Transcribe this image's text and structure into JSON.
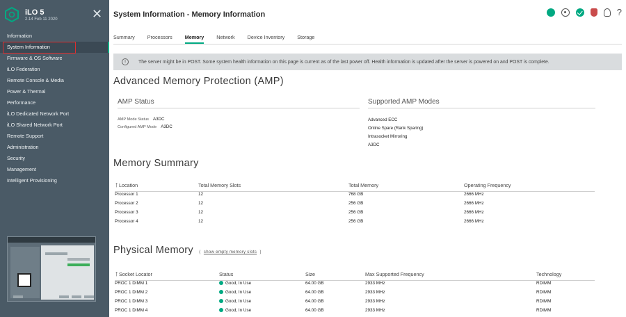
{
  "brand": {
    "title": "iLO 5",
    "subtitle": "2.14 Feb 11 2020"
  },
  "sidebar": {
    "items": [
      {
        "label": "Information"
      },
      {
        "label": "System Information"
      },
      {
        "label": "Firmware & OS Software"
      },
      {
        "label": "iLO Federation"
      },
      {
        "label": "Remote Console & Media"
      },
      {
        "label": "Power & Thermal"
      },
      {
        "label": "Performance"
      },
      {
        "label": "iLO Dedicated Network Port"
      },
      {
        "label": "iLO Shared Network Port"
      },
      {
        "label": "Remote Support"
      },
      {
        "label": "Administration"
      },
      {
        "label": "Security"
      },
      {
        "label": "Management"
      },
      {
        "label": "Intelligent Provisioning"
      }
    ],
    "active_index": 1
  },
  "header": {
    "title": "System Information - Memory Information",
    "help": "?"
  },
  "tabs": [
    "Summary",
    "Processors",
    "Memory",
    "Network",
    "Device Inventory",
    "Storage"
  ],
  "active_tab": "Memory",
  "notice": "The server might be in POST. Some system health information on this page is current as of the last power off. Health information is updated after the server is powered on and POST is complete.",
  "amp": {
    "heading": "Advanced Memory Protection (AMP)",
    "status_heading": "AMP Status",
    "modes_heading": "Supported AMP Modes",
    "status_label": "AMP Mode Status",
    "status_value": "A3DC",
    "configured_label": "Configured AMP Mode",
    "configured_value": "A3DC",
    "modes": [
      "Advanced ECC",
      "Online Spare (Rank Sparing)",
      "Intrasocket Mirroring",
      "A3DC"
    ]
  },
  "summary": {
    "heading": "Memory Summary",
    "columns": [
      "Location",
      "Total Memory Slots",
      "Total Memory",
      "Operating Frequency"
    ],
    "rows": [
      [
        "Processor 1",
        "12",
        "768 GB",
        "2666 MHz"
      ],
      [
        "Processor 2",
        "12",
        "256 GB",
        "2666 MHz"
      ],
      [
        "Processor 3",
        "12",
        "256 GB",
        "2666 MHz"
      ],
      [
        "Processor 4",
        "12",
        "256 GB",
        "2666 MHz"
      ]
    ]
  },
  "physical": {
    "heading": "Physical Memory",
    "paren_open": "(",
    "link": "show empty memory slots",
    "paren_close": ")",
    "columns": [
      "Socket Locator",
      "Status",
      "Size",
      "Max Supported Frequency",
      "Technology"
    ],
    "rows": [
      [
        "PROC 1 DIMM 1",
        "Good, In Use",
        "64.00 GB",
        "2933 MHz",
        "RDIMM"
      ],
      [
        "PROC 1 DIMM 2",
        "Good, In Use",
        "64.00 GB",
        "2933 MHz",
        "RDIMM"
      ],
      [
        "PROC 1 DIMM 3",
        "Good, In Use",
        "64.00 GB",
        "2933 MHz",
        "RDIMM"
      ],
      [
        "PROC 1 DIMM 4",
        "Good, In Use",
        "64.00 GB",
        "2933 MHz",
        "RDIMM"
      ]
    ]
  },
  "colors": {
    "accent": "#01a982",
    "sidebar": "#4a5a66",
    "alert": "#e02d2d"
  }
}
